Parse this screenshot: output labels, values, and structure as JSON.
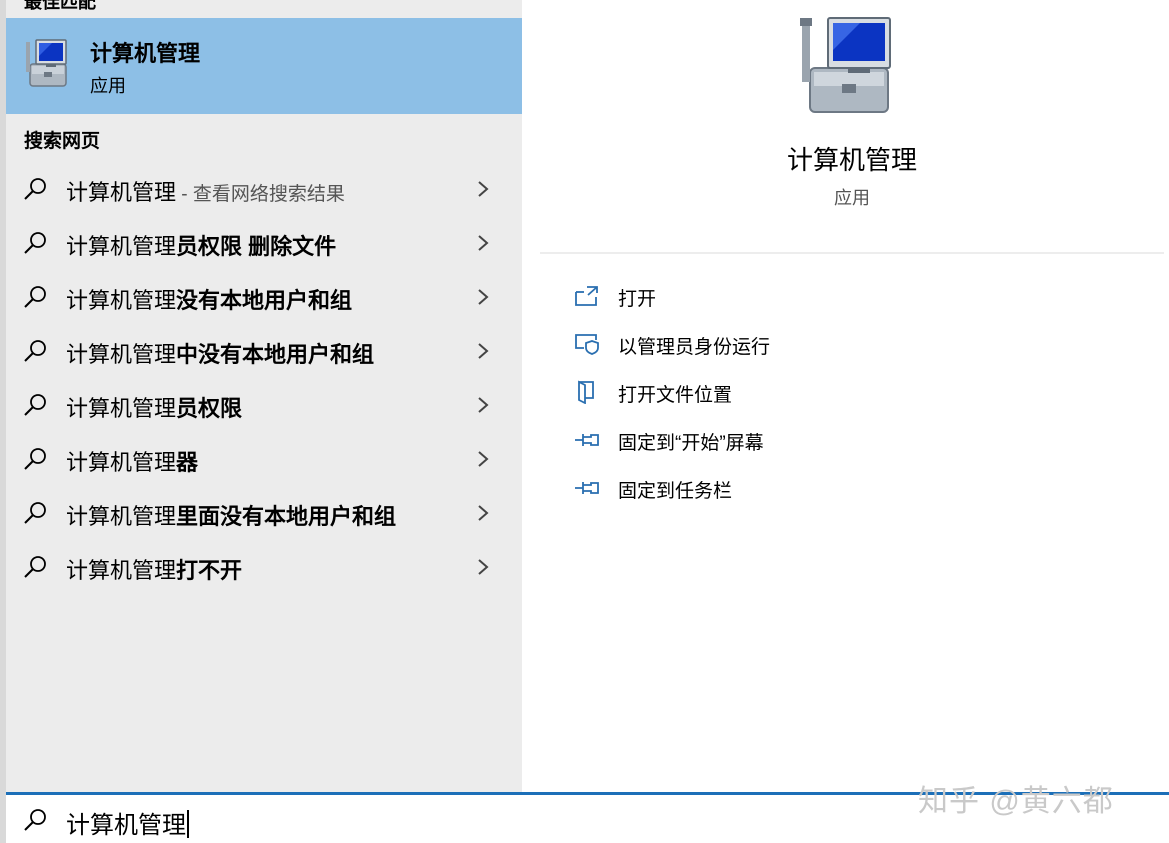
{
  "cut_section_label": "最佳匹配",
  "best_match": {
    "title": "计算机管理",
    "subtitle": "应用",
    "icon": "computer-management-icon"
  },
  "web_section_label": "搜索网页",
  "web_results": [
    {
      "prefix": "计算机管理",
      "bold": "",
      "hint": " - 查看网络搜索结果"
    },
    {
      "prefix": "计算机管理",
      "bold": "员权限 删除文件",
      "hint": ""
    },
    {
      "prefix": "计算机管理",
      "bold": "没有本地用户和组",
      "hint": ""
    },
    {
      "prefix": "计算机管理",
      "bold": "中没有本地用户和组",
      "hint": ""
    },
    {
      "prefix": "计算机管理",
      "bold": "员权限",
      "hint": ""
    },
    {
      "prefix": "计算机管理",
      "bold": "器",
      "hint": ""
    },
    {
      "prefix": "计算机管理",
      "bold": "里面没有本地用户和组",
      "hint": ""
    },
    {
      "prefix": "计算机管理",
      "bold": "打不开",
      "hint": ""
    }
  ],
  "detail": {
    "title": "计算机管理",
    "subtitle": "应用",
    "actions": [
      {
        "label": "打开",
        "icon": "open-icon"
      },
      {
        "label": "以管理员身份运行",
        "icon": "run-as-admin-icon"
      },
      {
        "label": "打开文件位置",
        "icon": "file-location-icon"
      },
      {
        "label": "固定到“开始”屏幕",
        "icon": "pin-icon"
      },
      {
        "label": "固定到任务栏",
        "icon": "pin-icon"
      }
    ]
  },
  "search": {
    "value": "计算机管理"
  },
  "watermark": "知乎 @黄六都",
  "colors": {
    "accent": "#1c6fb8",
    "selection": "#8dbfe6",
    "panel": "#ececec",
    "icon_blue": "#2a6fb0"
  }
}
